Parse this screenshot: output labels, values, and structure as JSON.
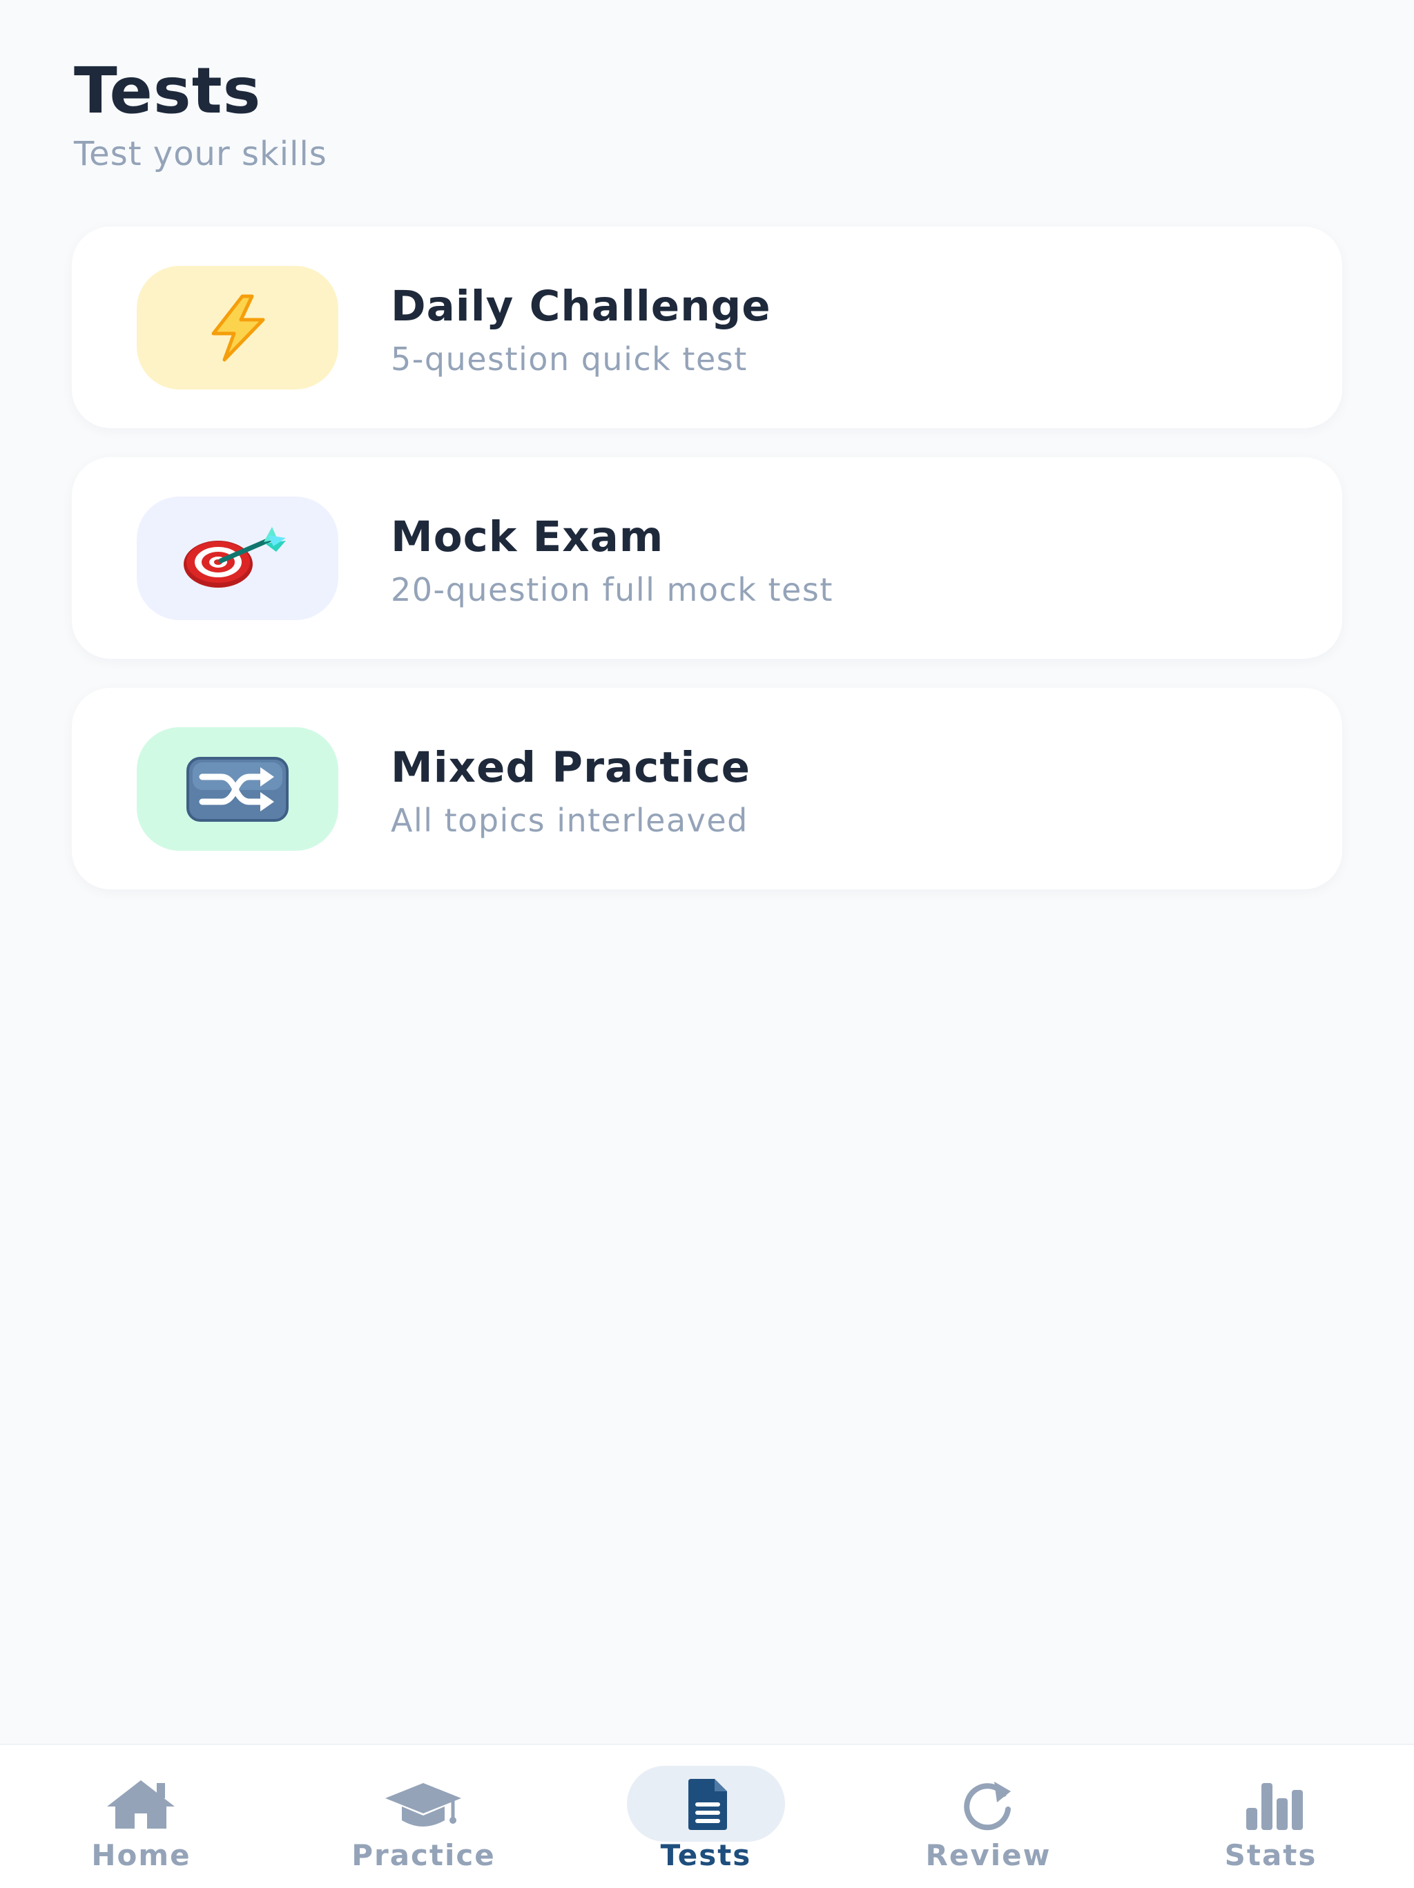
{
  "header": {
    "title": "Tests",
    "subtitle": "Test your skills"
  },
  "tests": [
    {
      "title": "Daily Challenge",
      "subtitle": "5-question quick test",
      "icon": "lightning-bolt-icon",
      "tile_color": "#fef3c7"
    },
    {
      "title": "Mock Exam",
      "subtitle": "20-question full mock test",
      "icon": "target-dart-icon",
      "tile_color": "#eef2ff"
    },
    {
      "title": "Mixed Practice",
      "subtitle": "All topics interleaved",
      "icon": "shuffle-icon",
      "tile_color": "#d1fae5"
    }
  ],
  "nav": {
    "active": "Tests",
    "items": [
      {
        "label": "Home",
        "icon": "home-icon"
      },
      {
        "label": "Practice",
        "icon": "graduation-cap-icon"
      },
      {
        "label": "Tests",
        "icon": "document-icon"
      },
      {
        "label": "Review",
        "icon": "refresh-icon"
      },
      {
        "label": "Stats",
        "icon": "bar-chart-icon"
      }
    ]
  },
  "colors": {
    "background": "#f8fafc",
    "text_primary": "#1e293b",
    "text_secondary": "#94a3b8",
    "nav_active": "#1e4e7d",
    "nav_inactive": "#94a3b8"
  }
}
